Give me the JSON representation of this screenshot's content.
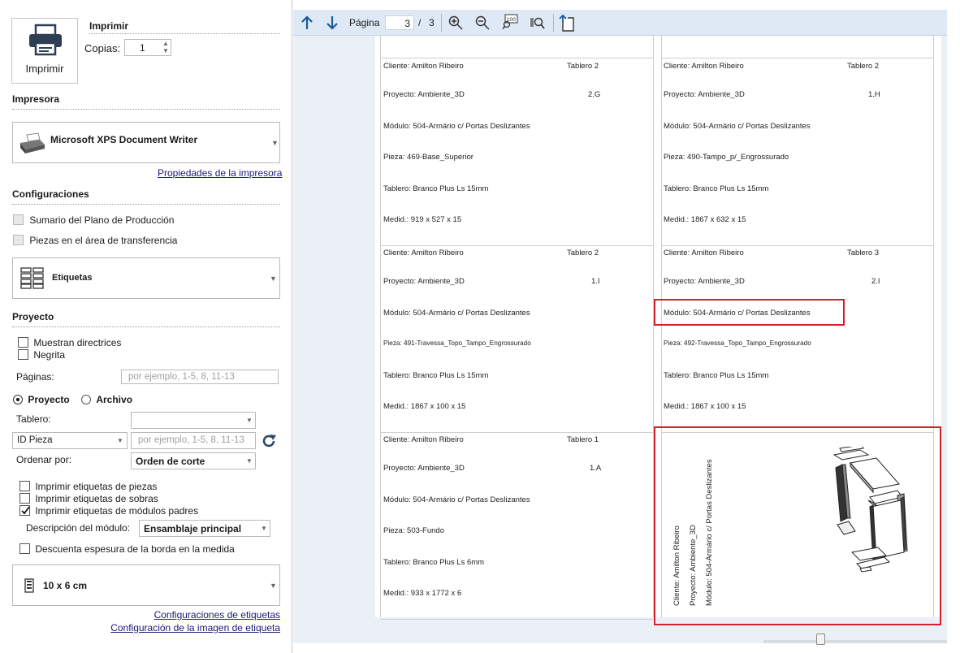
{
  "print": {
    "button_label": "Imprimir",
    "section_title": "Imprimir",
    "copies_label": "Copias:",
    "copies_value": "1"
  },
  "printer": {
    "section_title": "Impresora",
    "name": "Microsoft XPS Document Writer",
    "properties_link": "Propiedades de la impresora"
  },
  "configs": {
    "section_title": "Configuraciones",
    "opt1": "Sumario del Plano de Producción",
    "opt2": "Piezas en el área de transferencia",
    "mode": "Etiquetas"
  },
  "project": {
    "section_title": "Proyecto",
    "show_guides": "Muestran directrices",
    "bold": "Negrita",
    "pages_label": "Páginas:",
    "pages_placeholder": "por ejemplo, 1-5, 8, 11-13",
    "radio_project": "Proyecto",
    "radio_file": "Archivo",
    "board_label": "Tablero:",
    "id_select": "ID Pieza",
    "id_placeholder": "por ejemplo, 1-5, 8, 11-13",
    "sort_label": "Ordenar por:",
    "sort_value": "Orden de corte",
    "chk_parts": "Imprimir etiquetas de piezas",
    "chk_leftovers": "Imprimir etiquetas de sobras",
    "chk_parents": "Imprimir etiquetas de módulos padres",
    "desc_label": "Descripción del módulo:",
    "desc_value": "Ensamblaje principal",
    "chk_edge": "Descuenta espesura de la borda en la medida",
    "size_value": "10 x 6 cm",
    "link_label_cfg": "Configuraciones de etiquetas",
    "link_image_cfg": "Configuración de la imagen de etiqueta"
  },
  "toolbar": {
    "page_label": "Página",
    "page_current": "3",
    "page_sep": "/",
    "page_total": "3"
  },
  "labels": [
    {
      "cliente": "Cliente: Amilton Ribeiro",
      "tablero": "Tablero 2",
      "proyecto": "Proyecto: Ambiente_3D",
      "code": "2.G",
      "modulo": "Módulo: 504-Armário c/ Portas Deslizantes",
      "pieza": "Pieza: 469-Base_Superior",
      "material": "Tablero: Branco Plus Ls 15mm",
      "medid": "Medid.: 919 x 527 x 15"
    },
    {
      "cliente": "Cliente: Amilton Ribeiro",
      "tablero": "Tablero 2",
      "proyecto": "Proyecto: Ambiente_3D",
      "code": "1.H",
      "modulo": "Módulo: 504-Armário c/ Portas Deslizantes",
      "pieza": "Pieza: 490-Tampo_p/_Engrossurado",
      "material": "Tablero: Branco Plus Ls 15mm",
      "medid": "Medid.: 1867 x 632 x 15"
    },
    {
      "cliente": "Cliente: Amilton Ribeiro",
      "tablero": "Tablero 2",
      "proyecto": "Proyecto: Ambiente_3D",
      "code": "1.I",
      "modulo": "Módulo: 504-Armário c/ Portas Deslizantes",
      "pieza": "Pieza: 491-Travessa_Topo_Tampo_Engrossurado",
      "material": "Tablero: Branco Plus Ls 15mm",
      "medid": "Medid.: 1867 x 100 x 15"
    },
    {
      "cliente": "Cliente: Amilton Ribeiro",
      "tablero": "Tablero 3",
      "proyecto": "Proyecto: Ambiente_3D",
      "code": "2.I",
      "modulo": "Módulo: 504-Armário c/ Portas Deslizantes",
      "pieza": "Pieza: 492-Travessa_Topo_Tampo_Engrossurado",
      "material": "Tablero: Branco Plus Ls 15mm",
      "medid": "Medid.: 1867 x 100 x 15"
    },
    {
      "cliente": "Cliente: Amilton Ribeiro",
      "tablero": "Tablero 1",
      "proyecto": "Proyecto: Ambiente_3D",
      "code": "1.A",
      "modulo": "Módulo: 504-Armário c/ Portas Deslizantes",
      "pieza": "Pieza: 503-Fundo",
      "material": "Tablero: Branco Plus Ls 6mm",
      "medid": "Medid.: 933 x 1772 x 6"
    }
  ],
  "module_label": {
    "cliente": "Cliente: Amilton Ribeiro",
    "proyecto": "Proyecto: Ambiente_3D",
    "modulo": "Módulo: 504-Armário c/ Portas Deslizantes"
  }
}
